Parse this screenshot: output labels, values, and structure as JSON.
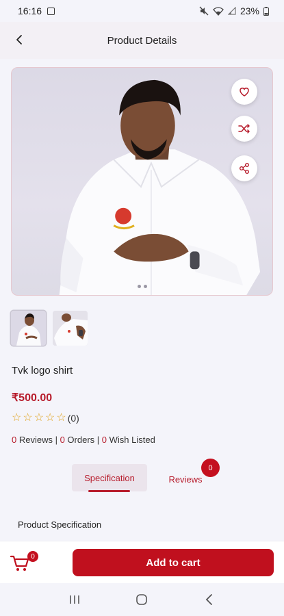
{
  "status_bar": {
    "time": "16:16",
    "battery": "23%",
    "icons": [
      "gallery-icon",
      "mute-icon",
      "wifi-icon",
      "signal-icon",
      "battery-icon"
    ]
  },
  "app_bar": {
    "title": "Product Details",
    "back_icon": "back-arrow-icon"
  },
  "product": {
    "name": "Tvk logo shirt",
    "price": "₹500.00",
    "rating_count": "(0)",
    "stars": 0,
    "stats": {
      "reviews_count": "0",
      "reviews_label": " Reviews | ",
      "orders_count": "0",
      "orders_label": " Orders | ",
      "wishlist_count": "0",
      "wishlist_label": " Wish Listed"
    },
    "actions": [
      "heart-icon",
      "shuffle-icon",
      "share-icon"
    ],
    "image_count": 2,
    "active_image": 0
  },
  "tabs": {
    "specification": "Specification",
    "reviews": "Reviews",
    "reviews_badge": "0",
    "active": "specification"
  },
  "spec_section": {
    "title": "Product Specification"
  },
  "bottom_bar": {
    "cart_badge": "0",
    "add_to_cart": "Add to cart"
  },
  "colors": {
    "accent": "#c0101e",
    "background": "#f4f4fa",
    "star": "#e0a21a"
  }
}
